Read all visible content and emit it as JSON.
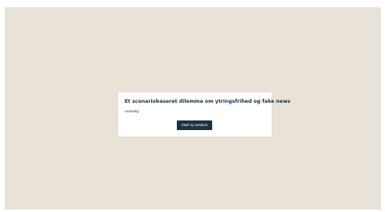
{
  "card": {
    "title": "Et scenariobaseret dilemma om ytringsfrihed og fake news",
    "organization": "Amnesty",
    "start_button_label": "Start ny session"
  },
  "colors": {
    "background": "#e9e2d6",
    "card": "#ffffff",
    "title_text": "#1f3047",
    "button": "#1e3143",
    "button_text": "#ffffff"
  }
}
